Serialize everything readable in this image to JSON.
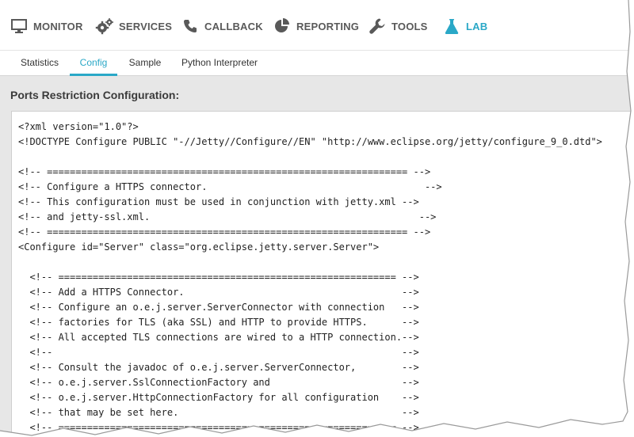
{
  "nav": {
    "items": [
      {
        "label": "MONITOR",
        "icon": "monitor-icon"
      },
      {
        "label": "SERVICES",
        "icon": "gears-icon"
      },
      {
        "label": "CALLBACK",
        "icon": "phone-icon"
      },
      {
        "label": "REPORTING",
        "icon": "pie-chart-icon"
      },
      {
        "label": "TOOLS",
        "icon": "wrench-icon"
      },
      {
        "label": "LAB",
        "icon": "flask-icon",
        "active": true
      }
    ]
  },
  "subnav": {
    "tabs": [
      {
        "label": "Statistics"
      },
      {
        "label": "Config",
        "active": true
      },
      {
        "label": "Sample"
      },
      {
        "label": "Python Interpreter"
      }
    ]
  },
  "section": {
    "title": "Ports Restriction Configuration:"
  },
  "editor": {
    "lines": [
      "<?xml version=\"1.0\"?>",
      "<!DOCTYPE Configure PUBLIC \"-//Jetty//Configure//EN\" \"http://www.eclipse.org/jetty/configure_9_0.dtd\">",
      "",
      "<!-- =============================================================== -->",
      "<!-- Configure a HTTPS connector.                                      -->",
      "<!-- This configuration must be used in conjunction with jetty.xml -->",
      "<!-- and jetty-ssl.xml.                                               -->",
      "<!-- =============================================================== -->",
      "<Configure id=\"Server\" class=\"org.eclipse.jetty.server.Server\">",
      "",
      "  <!-- =========================================================== -->",
      "  <!-- Add a HTTPS Connector.                                      -->",
      "  <!-- Configure an o.e.j.server.ServerConnector with connection   -->",
      "  <!-- factories for TLS (aka SSL) and HTTP to provide HTTPS.      -->",
      "  <!-- All accepted TLS connections are wired to a HTTP connection.-->",
      "  <!--                                                             -->",
      "  <!-- Consult the javadoc of o.e.j.server.ServerConnector,        -->",
      "  <!-- o.e.j.server.SslConnectionFactory and                       -->",
      "  <!-- o.e.j.server.HttpConnectionFactory for all configuration    -->",
      "  <!-- that may be set here.                                       -->",
      "  <!-- =========================================================== -->"
    ]
  },
  "colors": {
    "accent": "#2aa8c7",
    "nav_text": "#595959",
    "content_bg": "#e7e7e7"
  }
}
